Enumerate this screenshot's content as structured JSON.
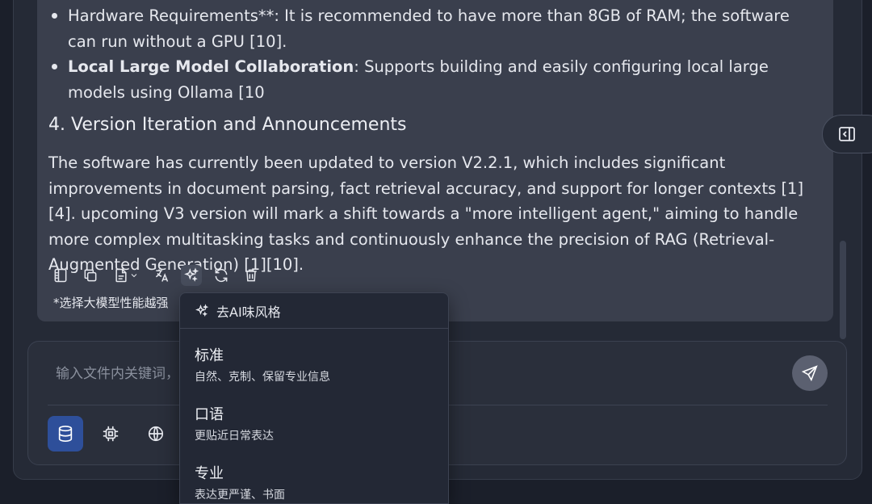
{
  "message": {
    "bullets": [
      {
        "bold": "",
        "text": "Hardware Requirements**: It is recommended to have more than 8GB of RAM; the software can run without a GPU [10]."
      },
      {
        "bold": "Local Large Model Collaboration",
        "text": ": Supports building and easily configuring local large models using Ollama [10"
      }
    ],
    "heading": "4. Version Iteration and Announcements",
    "paragraph": "The software has currently been updated to version V2.2.1, which includes significant improvements in document parsing, fact retrieval accuracy, and support for longer contexts [1][4]. upcoming V3 version will mark a shift towards a \"more intelligent agent,\" aiming to handle more complex multitasking tasks and continuously enhance the precision of RAG (Retrieval-Augmented Generation) [1][10].",
    "footnote": "*选择大模型性能越强"
  },
  "toolbar_icons": [
    "book-icon",
    "copy-icon",
    "document-icon",
    "chevron-down-icon",
    "translate-icon",
    "sparkle-icon",
    "refresh-icon",
    "trash-icon"
  ],
  "composer": {
    "placeholder": "输入文件内关键词，",
    "tools": [
      "database-icon",
      "cpu-icon",
      "globe-icon"
    ]
  },
  "dropdown": {
    "header": "去AI味风格",
    "options": [
      {
        "title": "标准",
        "desc": "自然、克制、保留专业信息"
      },
      {
        "title": "口语",
        "desc": "更贴近日常表达"
      },
      {
        "title": "专业",
        "desc": "表达更严谨、书面"
      }
    ]
  },
  "colors": {
    "background": "#1b1f2a",
    "card": "#3a3f4d",
    "accent": "#2e4f9a"
  }
}
